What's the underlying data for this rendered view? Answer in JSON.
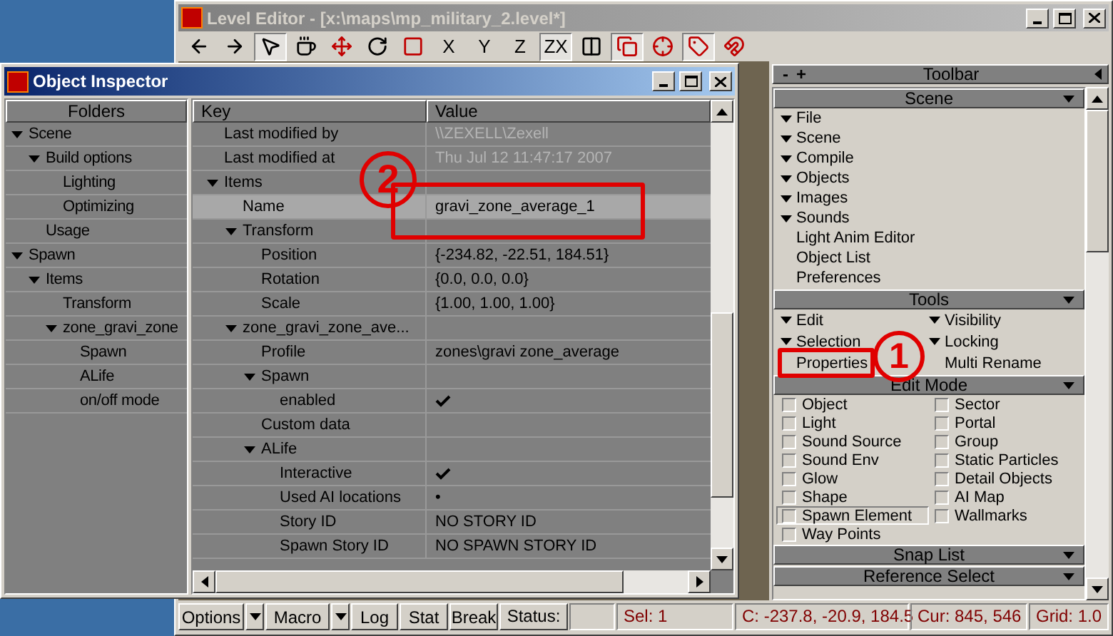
{
  "level_editor": {
    "title": "Level Editor - [x:\\maps\\mp_military_2.level*]",
    "toolbar": [
      {
        "kind": "icon",
        "pressed": false
      },
      {
        "kind": "icon",
        "pressed": false
      },
      {
        "kind": "icon",
        "pressed": true
      },
      {
        "kind": "icon",
        "pressed": false
      },
      {
        "kind": "icon",
        "pressed": false
      },
      {
        "kind": "icon",
        "pressed": false
      },
      {
        "kind": "icon",
        "pressed": false
      },
      {
        "kind": "text",
        "label": "X",
        "pressed": false
      },
      {
        "kind": "text",
        "label": "Y",
        "pressed": false
      },
      {
        "kind": "text",
        "label": "Z",
        "pressed": false
      },
      {
        "kind": "text",
        "label": "ZX",
        "pressed": true
      },
      {
        "kind": "icon",
        "pressed": false
      },
      {
        "kind": "icon",
        "pressed": true
      },
      {
        "kind": "icon",
        "pressed": false
      },
      {
        "kind": "icon",
        "pressed": true
      },
      {
        "kind": "icon",
        "pressed": false
      }
    ],
    "side_panel": {
      "title": "Toolbar",
      "header_buttons": [
        "-",
        "+"
      ],
      "sections": [
        {
          "title": "Scene",
          "kind": "list",
          "items": [
            {
              "label": "File",
              "kind": "menu"
            },
            {
              "label": "Scene",
              "kind": "menu"
            },
            {
              "label": "Compile",
              "kind": "menu"
            },
            {
              "label": "Objects",
              "kind": "menu"
            },
            {
              "label": "Images",
              "kind": "menu"
            },
            {
              "label": "Sounds",
              "kind": "menu"
            },
            {
              "label": "Light Anim Editor",
              "kind": "action"
            },
            {
              "label": "Object List",
              "kind": "action"
            },
            {
              "label": "Preferences",
              "kind": "action"
            }
          ]
        },
        {
          "title": "Tools",
          "kind": "list",
          "items": [
            {
              "label": "Edit",
              "kind": "menu"
            },
            {
              "label": "Visibility",
              "kind": "menu"
            },
            {
              "label": "Selection",
              "kind": "menu"
            },
            {
              "label": "Locking",
              "kind": "menu"
            },
            {
              "label": "Properties",
              "kind": "action"
            },
            {
              "label": "Multi Rename",
              "kind": "action"
            }
          ]
        },
        {
          "title": "Edit Mode",
          "kind": "checks",
          "items": [
            {
              "label": "Object",
              "checked": false,
              "selected": false
            },
            {
              "label": "Sector",
              "checked": false,
              "selected": false
            },
            {
              "label": "Light",
              "checked": false,
              "selected": false
            },
            {
              "label": "Portal",
              "checked": false,
              "selected": false
            },
            {
              "label": "Sound Source",
              "checked": false,
              "selected": false
            },
            {
              "label": "Group",
              "checked": false,
              "selected": false
            },
            {
              "label": "Sound Env",
              "checked": false,
              "selected": false
            },
            {
              "label": "Static Particles",
              "checked": false,
              "selected": false
            },
            {
              "label": "Glow",
              "checked": false,
              "selected": false
            },
            {
              "label": "Detail Objects",
              "checked": false,
              "selected": false
            },
            {
              "label": "Shape",
              "checked": false,
              "selected": false
            },
            {
              "label": "AI Map",
              "checked": false,
              "selected": false
            },
            {
              "label": "Spawn Element",
              "checked": false,
              "selected": true
            },
            {
              "label": "Wallmarks",
              "checked": false,
              "selected": false
            },
            {
              "label": "Way Points",
              "checked": false,
              "selected": false
            }
          ]
        },
        {
          "title": "Snap List",
          "kind": "header"
        },
        {
          "title": "Reference Select",
          "kind": "header"
        }
      ]
    },
    "status_bar": [
      {
        "kind": "button",
        "label": "Options"
      },
      {
        "kind": "dropdown"
      },
      {
        "kind": "button",
        "label": "Macro"
      },
      {
        "kind": "dropdown"
      },
      {
        "kind": "button",
        "label": "Log"
      },
      {
        "kind": "button",
        "label": "Stat"
      },
      {
        "kind": "button",
        "label": "Break"
      },
      {
        "kind": "label",
        "label": "Status:"
      },
      {
        "kind": "empty"
      },
      {
        "kind": "readout",
        "label": "Sel: 1"
      },
      {
        "kind": "readout",
        "label": "C: -237.8, -20.9, 184.5"
      },
      {
        "kind": "readout",
        "label": "Cur: 845, 546"
      },
      {
        "kind": "readout",
        "label": "Grid: 1.0"
      }
    ]
  },
  "object_inspector": {
    "title": "Object Inspector",
    "folders": {
      "heading": "Folders",
      "items": [
        {
          "label": "Scene",
          "expanded": true,
          "children": [
            {
              "label": "Build options",
              "expanded": true,
              "children": [
                {
                  "label": "Lighting"
                },
                {
                  "label": "Optimizing"
                }
              ]
            },
            {
              "label": "Usage"
            }
          ]
        },
        {
          "label": "Spawn",
          "expanded": true,
          "children": [
            {
              "label": "Items",
              "expanded": true,
              "children": [
                {
                  "label": "Transform"
                },
                {
                  "label": "zone_gravi_zone",
                  "expanded": true,
                  "children": [
                    {
                      "label": "Spawn"
                    },
                    {
                      "label": "ALife"
                    },
                    {
                      "label": "on/off mode"
                    }
                  ]
                }
              ]
            }
          ]
        }
      ]
    },
    "properties": {
      "columns": [
        "Key",
        "Value"
      ],
      "rows": [
        {
          "key": "Last modified by",
          "value": "\\\\ZEXELL\\Zexell",
          "disabled": true,
          "selected": false
        },
        {
          "key": "Last modified at",
          "value": "Thu Jul 12 11:47:17 2007",
          "disabled": true,
          "selected": false
        },
        {
          "key": "Items",
          "expanded": true,
          "selected": false,
          "children": [
            {
              "key": "Name",
              "value": "gravi_zone_average_1",
              "disabled": false,
              "selected": true
            },
            {
              "key": "Transform",
              "expanded": true,
              "selected": false,
              "children": [
                {
                  "key": "Position",
                  "value": "{-234.82, -22.51, 184.51}",
                  "disabled": false,
                  "selected": false
                },
                {
                  "key": "Rotation",
                  "value": "{0.0, 0.0, 0.0}",
                  "disabled": false,
                  "selected": false
                },
                {
                  "key": "Scale",
                  "value": "{1.00, 1.00, 1.00}",
                  "disabled": false,
                  "selected": false
                }
              ]
            },
            {
              "key": "zone_gravi_zone_ave...",
              "expanded": true,
              "selected": false,
              "children": [
                {
                  "key": "Profile",
                  "value": "zones\\gravi zone_average",
                  "disabled": false,
                  "selected": false
                },
                {
                  "key": "Spawn",
                  "expanded": true,
                  "selected": false,
                  "children": [
                    {
                      "key": "enabled",
                      "kind": "check",
                      "checked": true,
                      "selected": false
                    }
                  ]
                },
                {
                  "key": "Custom data",
                  "selected": false
                },
                {
                  "key": "ALife",
                  "expanded": true,
                  "selected": false,
                  "children": [
                    {
                      "key": "Interactive",
                      "kind": "check",
                      "checked": true,
                      "selected": false
                    },
                    {
                      "key": "Used AI locations",
                      "value": "•",
                      "disabled": false,
                      "selected": false
                    },
                    {
                      "key": "Story ID",
                      "value": "NO STORY ID",
                      "disabled": false,
                      "selected": false
                    },
                    {
                      "key": "Spawn Story ID",
                      "value": "NO SPAWN STORY ID",
                      "disabled": false,
                      "selected": false
                    }
                  ]
                }
              ]
            }
          ]
        }
      ]
    }
  },
  "annotations": [
    {
      "label": "2"
    },
    {
      "label": "1"
    }
  ]
}
